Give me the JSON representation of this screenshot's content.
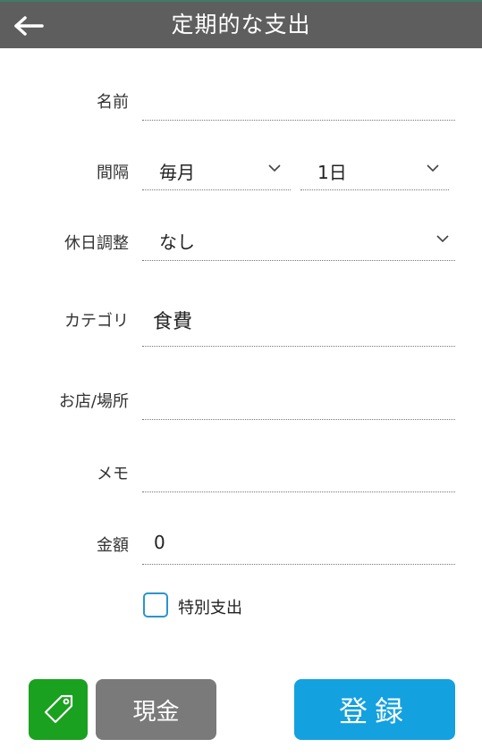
{
  "header": {
    "title": "定期的な支出"
  },
  "form": {
    "name": {
      "label": "名前",
      "value": ""
    },
    "interval": {
      "label": "間隔",
      "frequency": "毎月",
      "day": "1日"
    },
    "holiday": {
      "label": "休日調整",
      "value": "なし"
    },
    "category": {
      "label": "カテゴリ",
      "value": "食費"
    },
    "shop": {
      "label": "お店/場所",
      "value": ""
    },
    "memo": {
      "label": "メモ",
      "value": ""
    },
    "amount": {
      "label": "金額",
      "value": "0"
    },
    "special": {
      "label": "特別支出",
      "checked": false
    }
  },
  "footer": {
    "tag_icon": "tag-icon",
    "payment_label": "現金",
    "register_label": "登録"
  },
  "colors": {
    "header_bg": "#5e5e5e",
    "tag_button": "#1aa11f",
    "payment_button": "#7a7a7a",
    "register_button": "#13a1e0",
    "checkbox_border": "#2b95c9"
  }
}
